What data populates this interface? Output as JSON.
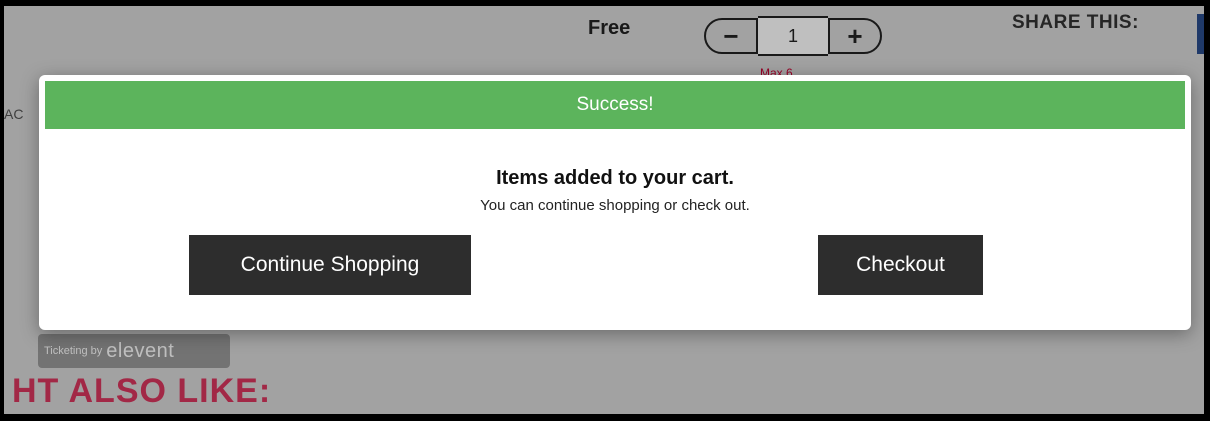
{
  "background": {
    "price_text": "Free",
    "quantity": {
      "minus_label": "−",
      "value": "1",
      "plus_label": "+"
    },
    "max_note": "Max 6",
    "share_label": "SHARE THIS:",
    "left_edge_text": "AC",
    "ticketing": {
      "prefix": "Ticketing by",
      "brand": "elevent"
    },
    "also_like": "HT ALSO LIKE:"
  },
  "modal": {
    "header": "Success!",
    "heading": "Items added to your cart.",
    "subtext": "You can continue shopping or check out.",
    "continue_label": "Continue Shopping",
    "checkout_label": "Checkout"
  },
  "colors": {
    "success_green": "#5cb45c",
    "button_dark": "#2d2d2d",
    "accent_pink": "#d8365e",
    "share_blue": "#2a4d8c"
  }
}
